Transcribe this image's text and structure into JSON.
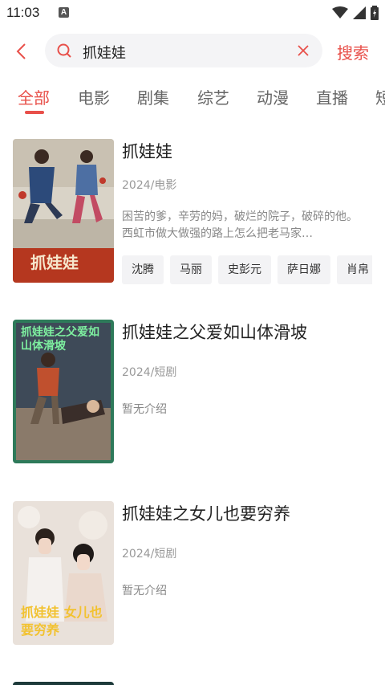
{
  "status_bar": {
    "time": "11:03",
    "badge": "A"
  },
  "search": {
    "query": "抓娃娃",
    "submit_label": "搜索"
  },
  "tabs": [
    {
      "label": "全部",
      "active": true
    },
    {
      "label": "电影"
    },
    {
      "label": "剧集"
    },
    {
      "label": "综艺"
    },
    {
      "label": "动漫"
    },
    {
      "label": "直播"
    },
    {
      "label": "短"
    }
  ],
  "results": [
    {
      "title": "抓娃娃",
      "meta": "2024/电影",
      "description": "困苦的爹，辛劳的妈，破烂的院子，破碎的他。西虹市做大做强的路上怎么把老马家…",
      "cast": [
        "沈腾",
        "马丽",
        "史彭元",
        "萨日娜",
        "肖帛"
      ],
      "poster_caption": "抓娃娃"
    },
    {
      "title": "抓娃娃之父爱如山体滑坡",
      "meta": "2024/短剧",
      "description": "暂无介绍",
      "poster_caption": "抓娃娃之父爱如山体滑坡"
    },
    {
      "title": "抓娃娃之女儿也要穷养",
      "meta": "2024/短剧",
      "description": "暂无介绍",
      "poster_caption": "抓娃娃 女儿也要穷养"
    }
  ],
  "colors": {
    "accent": "#e8504a",
    "text": "#222222",
    "muted": "#999999",
    "chip_bg": "#f3f3f5"
  }
}
